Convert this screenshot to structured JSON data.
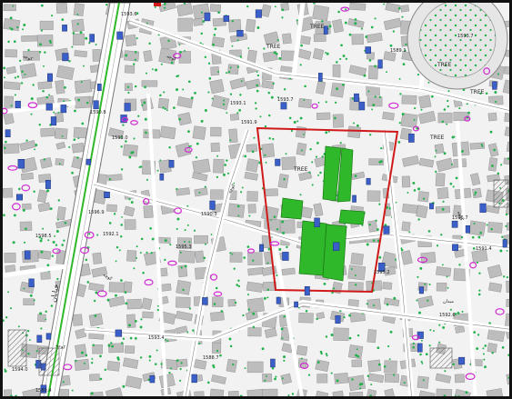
{
  "map": {
    "colors": {
      "building": "#bdbdbd",
      "building_edge": "#8a8a8a",
      "street": "#f7f7f7",
      "tree_dot": "#22b14c",
      "green_space": "#2fb829",
      "site_boundary": "#d01a1a",
      "water_tank": "#3a5fc8",
      "poi_magenta": "#d02bd0",
      "elevation_red": "#e0201a",
      "frame": "#111111"
    },
    "tree_labels": [
      "TREE",
      "TREE",
      "TREE",
      "TREE",
      "TREE",
      "TREE"
    ],
    "elevations": [
      "1593.6",
      "1593.7",
      "1593.1",
      "1593.0",
      "1591.9",
      "1590.8",
      "1596.9",
      "1598.5",
      "1592.1",
      "1595.3",
      "1590.3",
      "1589.4",
      "1594.0",
      "1593.4",
      "1591.4",
      "1593.7",
      "1595.2",
      "1592.6",
      "1589.1",
      "1596.7",
      "1588.7"
    ],
    "street_labels": [
      "خیابان",
      "کوچه",
      "کوچه",
      "کوچه",
      "کوچه",
      "میدان",
      "کوچه",
      "کوچه"
    ]
  }
}
